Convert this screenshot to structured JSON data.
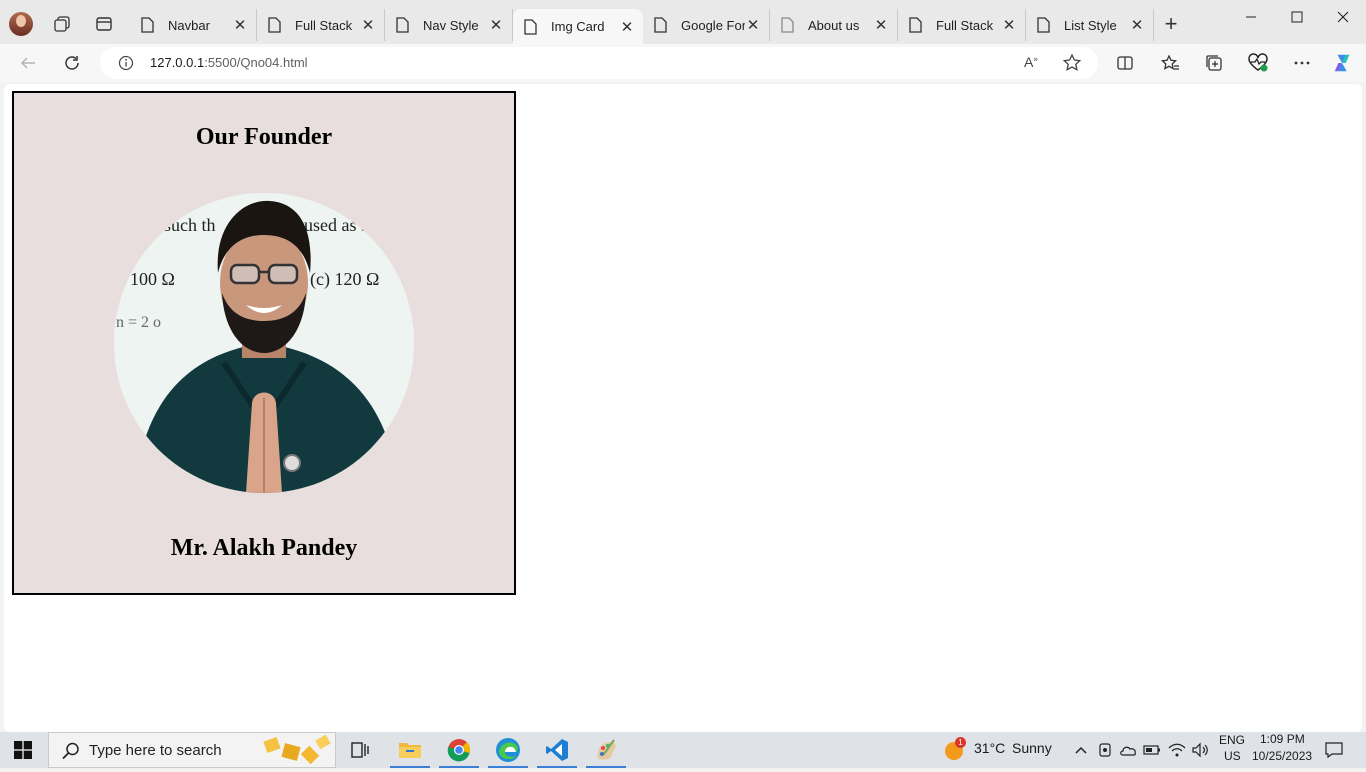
{
  "browser": {
    "tabs": [
      {
        "label": "Navbar",
        "active": false
      },
      {
        "label": "Full Stack",
        "active": false
      },
      {
        "label": "Nav Style",
        "active": false
      },
      {
        "label": "Img Card",
        "active": true
      },
      {
        "label": "Google Fon",
        "active": false
      },
      {
        "label": "About us",
        "active": false
      },
      {
        "label": "Full Stack",
        "active": false
      },
      {
        "label": "List Style",
        "active": false
      }
    ],
    "url_host": "127.0.0.1",
    "url_rest": ":5500/Qno04.html"
  },
  "page": {
    "heading": "Our Founder",
    "name": "Mr. Alakh Pandey",
    "photo_board_text": [
      "such th",
      "used as a",
      "100 Ω",
      "(c) 120 Ω",
      "n = 2 o"
    ]
  },
  "taskbar": {
    "search_placeholder": "Type here to search",
    "weather_temp": "31°C",
    "weather_text": "Sunny",
    "weather_badge": "1",
    "lang_top": "ENG",
    "lang_bottom": "US",
    "time": "1:09 PM",
    "date": "10/25/2023"
  },
  "colors": {
    "card_bg": "#e8dede",
    "tab_strip": "#e9e9e9",
    "taskbar": "#dfe3e8",
    "accent": "#3a7fd5"
  }
}
